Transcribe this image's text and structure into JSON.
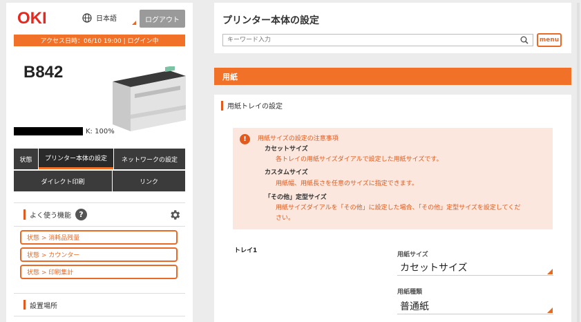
{
  "header": {
    "logo_text": "OKI",
    "language": "日本語",
    "logout_label": "ログアウト",
    "access_info": "アクセス日時：06/10 19:00 | ログイン中"
  },
  "device": {
    "model": "B842",
    "toner_label": "K: 100%",
    "toner_level": 1.0
  },
  "nav": {
    "row1": [
      "状態",
      "プリンター本体の設定",
      "ネットワークの設定"
    ],
    "row2": [
      "ダイレクト印刷",
      "リンク"
    ],
    "active": "プリンター本体の設定"
  },
  "favorites": {
    "title": "よく使う機能",
    "help": "?",
    "links": [
      "状態 > 消耗品残量",
      "状態 > カウンター",
      "状態 > 印刷集計"
    ]
  },
  "location": {
    "title": "設置場所"
  },
  "main": {
    "page_title": "プリンター本体の設定",
    "search_placeholder": "キーワード入力",
    "menu_label": "menu",
    "section": "用紙",
    "subsection": "用紙トレイの設定",
    "notice": {
      "title": "用紙サイズの設定の注意事項",
      "items": [
        {
          "heading": "カセットサイズ",
          "desc": "各トレイの用紙サイズダイアルで設定した用紙サイズです。"
        },
        {
          "heading": "カスタムサイズ",
          "desc": "用紙幅、用紙長さを任意のサイズに指定できます。"
        },
        {
          "heading": "「その他」定型サイズ",
          "desc1": "用紙サイズダイアルを「その他」に設定した場合、「その他」定型サイズを設定してくだ",
          "desc2": "さい。"
        }
      ]
    },
    "tray": {
      "label": "トレイ1",
      "paper_size_label": "用紙サイズ",
      "paper_size_value": "カセットサイズ",
      "paper_type_label": "用紙種類",
      "paper_type_value": "普通紙"
    }
  },
  "colors": {
    "accent": "#f07127",
    "dark_nav": "#3b3b3b",
    "notice_bg": "#fbe7dd"
  }
}
